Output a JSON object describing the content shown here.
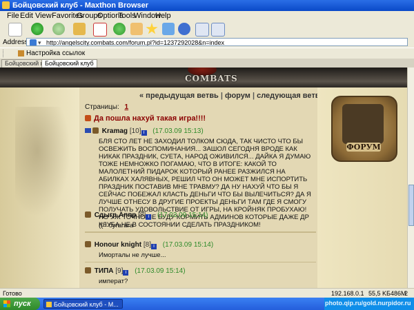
{
  "window": {
    "title": "Бойцовский клуб - Maxthon Browser"
  },
  "menu": [
    "File",
    "Edit",
    "View",
    "Favorites",
    "Groups",
    "Options",
    "Tools",
    "Window",
    "Help"
  ],
  "address": {
    "label": "Address",
    "url": "http://angelscity.combats.com/forum.pl?id=1237292028&n=index"
  },
  "links": {
    "item": "Настройка ссылок"
  },
  "tabs": [
    "Бойцовский клуб",
    "Бойцовский клуб"
  ],
  "site": {
    "logo": "COMBATS",
    "nav": {
      "prev": "« предыдущая ветвь",
      "forum": "форум",
      "next": "следующая ветвь »"
    },
    "pages_label": "Страницы:",
    "page_number": "1",
    "topic": "Да пошла нахуй такая игра!!!!",
    "forum_badge": "ФОРУМ"
  },
  "posts": [
    {
      "author": "Kramag",
      "level": "[10]",
      "date": "(17.03.09 15:13)",
      "text": "БЛЯ СТО ЛЕТ НЕ ЗАХОДИЛ ТОЛКОМ СЮДА, ТАК ЧИСТО ЧТО БЫ ОСВЕЖИТЬ ВОСПОМИНАНИЯ... ЗАШОЛ СЕГОДНЯ ВРОДЕ КАК НИКАК ПРАЗДНИК, СУЕТА, НАРОД ОЖИВИЛСЯ... ДАЙКА Я ДУМАЮ ТОЖЕ НЕМНОЖКО ПОГАМАЮ, ЧТО В ИТОГЕ: КАКОЙ ТО МАЛОЛЕТНИЙ ПИДАРОК КОТОРЫЙ РАНЕЕ РАЗЖИЛСЯ НА АБИЛКАХ ХАЛЯВНЫХ, РЕШИЛ ЧТО ОН МОЖЕТ МНЕ ИСПОРТИТЬ ПРАЗДНИК ПОСТАВИВ МНЕ ТРАВМУ? ДА НУ НАХУЙ ЧТО БЫ Я СЕЙЧАС ПОБЕЖАЛ КЛАСТЬ ДЕНЬГИ ЧТО БЫ ВЫЛЕЧИТЬСЯ? ДА Я ЛУЧШЕ ОТНЕСУ В ДРУГИЕ ПРОЕКТЫ ДЕНЬГИ ТАМ ГДЕ Я СМОГУ ПОЛУЧАТЬ УДОВОЛЬСТВИЕ ОТ ИГРЫ, НА КРОЙНЯК ПРОБУХАЮ! НО УЖ ТОЧНО НЕ БУДУ КОРМИТЬ АДМИНОВ КОТОРЫЕ ДАЖЕ ДР КЛУБА НЕ В СОСТОЯНИИ СДЕЛАТЬ ПРАЗДНИКОМ!"
    },
    {
      "author": "Сдыгр Аппр",
      "level": "[8]",
      "date": "(17.03.09 15:14)",
      "text": "((= бугагага"
    },
    {
      "author": "Honour knight",
      "level": "[8]",
      "date": "(17.03.09 15:14)",
      "text": "Иморталы не лучше..."
    },
    {
      "author": "ТИПА",
      "level": "[9]",
      "date": "(17.03.09 15:14)",
      "text": "императ?"
    }
  ],
  "status": {
    "text": "Готово",
    "ip": "192.168.0.1",
    "speed": "55,5 KБ",
    "memory": "486M",
    "pct": "2 %"
  },
  "taskbar": {
    "start": "пуск",
    "task": "Бойцовский клуб - M...",
    "watermark": "photo.qip.ru/gold.nurpidor.ru"
  }
}
